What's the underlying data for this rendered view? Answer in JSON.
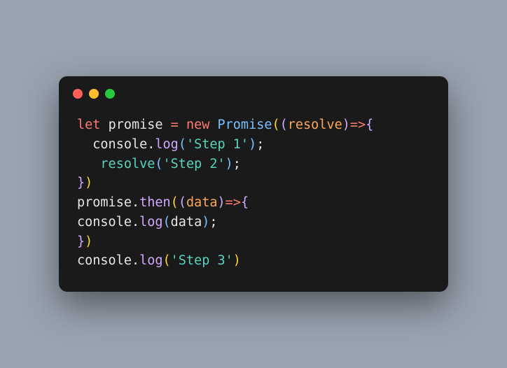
{
  "window": {
    "dots": [
      "red",
      "yellow",
      "green"
    ]
  },
  "code": {
    "line1": {
      "let": "let",
      "sp1": " ",
      "promise": "promise",
      "sp2": " ",
      "eq": "=",
      "sp3": " ",
      "new": "new",
      "sp4": " ",
      "Promise": "Promise",
      "lp1": "(",
      "lp2": "(",
      "resolve": "resolve",
      "rp1": ")",
      "arrow": "=>",
      "lb": "{"
    },
    "line2": {
      "indent": "  ",
      "console": "console",
      "dot": ".",
      "log": "log",
      "lp": "(",
      "str": "'Step 1'",
      "rp": ")",
      "semi": ";"
    },
    "line3": {
      "indent": "   ",
      "resolve": "resolve",
      "lp": "(",
      "str": "'Step 2'",
      "rp": ")",
      "semi": ";"
    },
    "line4": {
      "rb": "}",
      "rp": ")"
    },
    "line5": {
      "promise": "promise",
      "dot": ".",
      "then": "then",
      "lp1": "(",
      "lp2": "(",
      "data": "data",
      "rp1": ")",
      "arrow": "=>",
      "lb": "{"
    },
    "line6": {
      "console": "console",
      "dot": ".",
      "log": "log",
      "lp": "(",
      "data": "data",
      "rp": ")",
      "semi": ";"
    },
    "line7": {
      "rb": "}",
      "rp": ")"
    },
    "line8": {
      "console": "console",
      "dot": ".",
      "log": "log",
      "lp": "(",
      "str": "'Step 3'",
      "rp": ")"
    }
  }
}
